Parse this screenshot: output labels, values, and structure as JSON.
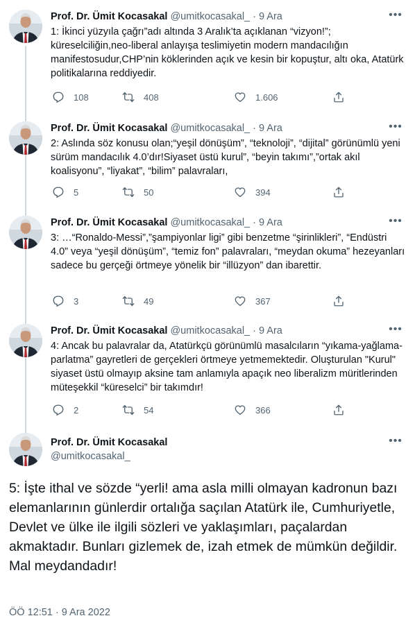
{
  "author": {
    "name": "Prof. Dr. Ümit Kocasakal",
    "handle": "@umitkocasakal_"
  },
  "tweets": [
    {
      "meta": "@umitkocasakal_ · 9 Ara",
      "text": "1: İkinci yüzyıla çağrı”adı altında 3 Aralık’ta açıklanan “vizyon!”; küreselciliğin,neo-liberal anlayışa teslimiyetin modern mandacılığın manifestosudur,CHP’nin köklerinden açık ve kesin bir kopuştur, altı oka, Atatürk politikalarına reddiyedir.",
      "replies": "108",
      "retweets": "408",
      "likes": "1.606"
    },
    {
      "meta": "@umitkocasakal_ · 9 Ara",
      "text": "2: Aslında söz konusu olan;“yeşil dönüşüm”, “teknoloji”, “dijital” görünümlü yeni sürüm mandacılık 4.0’dır!Siyaset üstü kurul”, “beyin takımı”,”ortak akıl koalisyonu”, “liyakat”, “bilim” palavraları,",
      "replies": "5",
      "retweets": "50",
      "likes": "394"
    },
    {
      "meta": "@umitkocasakal_ · 9 Ara",
      "text": "3:  …“Ronaldo-Messi”,”şampiyonlar ligi” gibi benzetme “şirinlikleri”, “Endüstri 4.0” veya “yeşil  dönüşüm”, “temiz fon” palavraları, “meydan okuma” hezeyanları sadece bu gerçeği örtmeye yönelik bir “illüzyon” dan ibarettir.",
      "replies": "3",
      "retweets": "49",
      "likes": "367"
    },
    {
      "meta": "@umitkocasakal_ · 9 Ara",
      "text": "4: Ancak bu palavralar da, Atatürkçü görünümlü masalcıların “yıkama-yağlama-parlatma” gayretleri de gerçekleri örtmeye yetmemektedir. Oluşturulan \"Kurul\" siyaset üstü olmayıp aksine  tam anlamıyla apaçık  neo liberalizm müritlerinden müteşekkil “küreselci” bir takımdır!",
      "replies": "2",
      "retweets": "54",
      "likes": "366"
    }
  ],
  "main_tweet": {
    "name": "Prof. Dr. Ümit Kocasakal",
    "handle": "@umitkocasakal_",
    "text": "5: İşte ithal ve sözde  “yerli! ama asla milli olmayan kadronun bazı elemanlarının günlerdir ortalığa saçılan Atatürk ile, Cumhuriyetle, Devlet ve ülke ile ilgili sözleri ve yaklaşımları, paçalardan akmaktadır. Bunları gizlemek de, izah etmek de mümkün değildir. Mal meydandadır!",
    "timestamp": "ÖÖ 12:51 · 9 Ara 2022"
  },
  "icons": [
    "more-icon",
    "reply-icon",
    "retweet-icon",
    "like-icon",
    "share-icon"
  ],
  "colors": {
    "text": "#0f1419",
    "secondary": "#536471",
    "thread_line": "#cfd9de"
  }
}
